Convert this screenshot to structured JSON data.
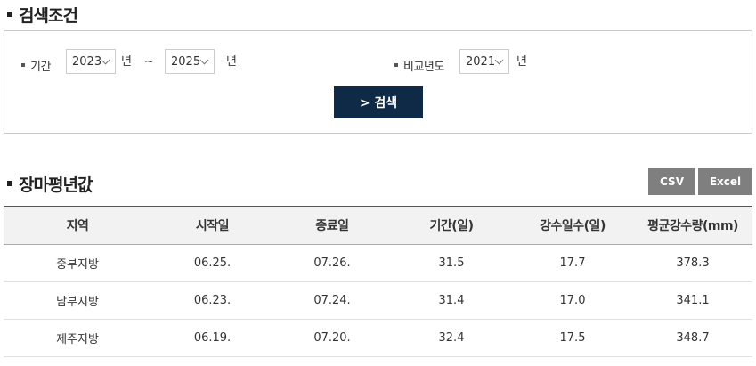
{
  "search_section": {
    "title": "검색조건",
    "period_label": "기간",
    "start_year": "2023",
    "end_year": "2025",
    "year_unit": "년",
    "range_sep": "~",
    "compare_label": "비교년도",
    "compare_year": "2021",
    "search_button": "> 검색"
  },
  "result_section": {
    "title": "장마평년값",
    "csv_button": "CSV",
    "excel_button": "Excel"
  },
  "table": {
    "headers": [
      "지역",
      "시작일",
      "종료일",
      "기간(일)",
      "강수일수(일)",
      "평균강수량(mm)"
    ],
    "rows": [
      [
        "중부지방",
        "06.25.",
        "07.26.",
        "31.5",
        "17.7",
        "378.3"
      ],
      [
        "남부지방",
        "06.23.",
        "07.24.",
        "31.4",
        "17.0",
        "341.1"
      ],
      [
        "제주지방",
        "06.19.",
        "07.20.",
        "32.4",
        "17.5",
        "348.7"
      ]
    ]
  },
  "colors": {
    "search_button_bg": "#0f2a47",
    "download_button_bg": "#7f7f7f",
    "header_bg": "#f2f2f2"
  }
}
